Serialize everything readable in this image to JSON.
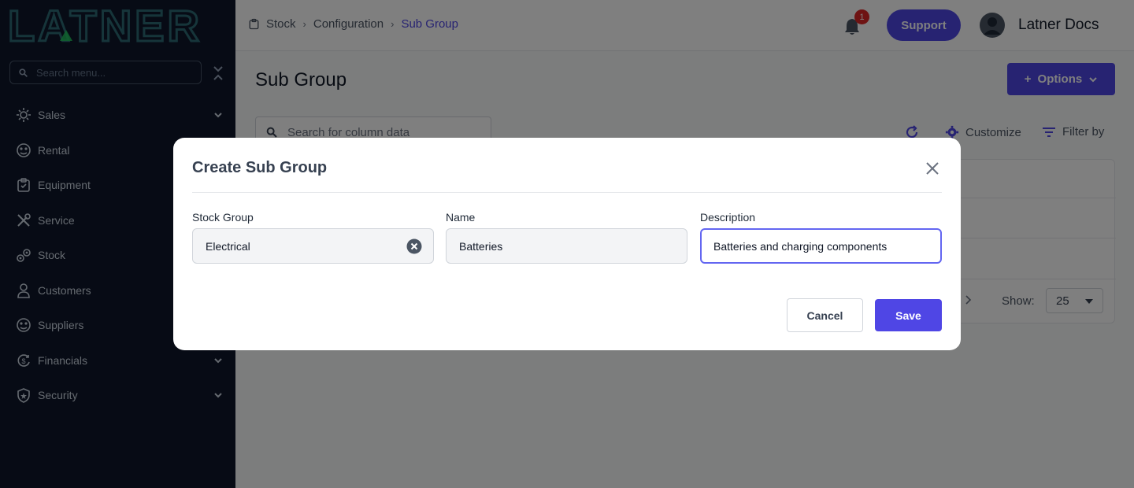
{
  "sidebar": {
    "logo_text": "LATNER",
    "search_placeholder": "Search menu...",
    "items": [
      {
        "label": "Sales",
        "icon": "sales-icon",
        "expandable": true
      },
      {
        "label": "Rental",
        "icon": "rental-icon",
        "expandable": false
      },
      {
        "label": "Equipment",
        "icon": "equipment-icon",
        "expandable": false
      },
      {
        "label": "Service",
        "icon": "service-icon",
        "expandable": false
      },
      {
        "label": "Stock",
        "icon": "stock-icon",
        "expandable": false
      },
      {
        "label": "Customers",
        "icon": "customers-icon",
        "expandable": false
      },
      {
        "label": "Suppliers",
        "icon": "suppliers-icon",
        "expandable": false
      },
      {
        "label": "Financials",
        "icon": "financials-icon",
        "expandable": true
      },
      {
        "label": "Security",
        "icon": "security-icon",
        "expandable": true
      }
    ]
  },
  "header": {
    "breadcrumb": [
      "Stock",
      "Configuration",
      "Sub Group"
    ],
    "notification_count": "1",
    "support_label": "Support",
    "user_name": "Latner Docs"
  },
  "page": {
    "title": "Sub Group",
    "options_label": "Options",
    "column_search_placeholder": "Search for column data",
    "customize_label": "Customize",
    "filter_label": "Filter by",
    "show_label": "Show:",
    "page_size": "25"
  },
  "modal": {
    "title": "Create Sub Group",
    "fields": [
      {
        "label": "Stock Group",
        "value": "Electrical"
      },
      {
        "label": "Name",
        "value": "Batteries"
      },
      {
        "label": "Description",
        "value": "Batteries and charging components"
      }
    ],
    "cancel_label": "Cancel",
    "save_label": "Save"
  },
  "colors": {
    "accent": "#4f46e5",
    "sidebar_bg": "#0f172a",
    "logo": "#2d6a75",
    "badge": "#dc2626"
  }
}
